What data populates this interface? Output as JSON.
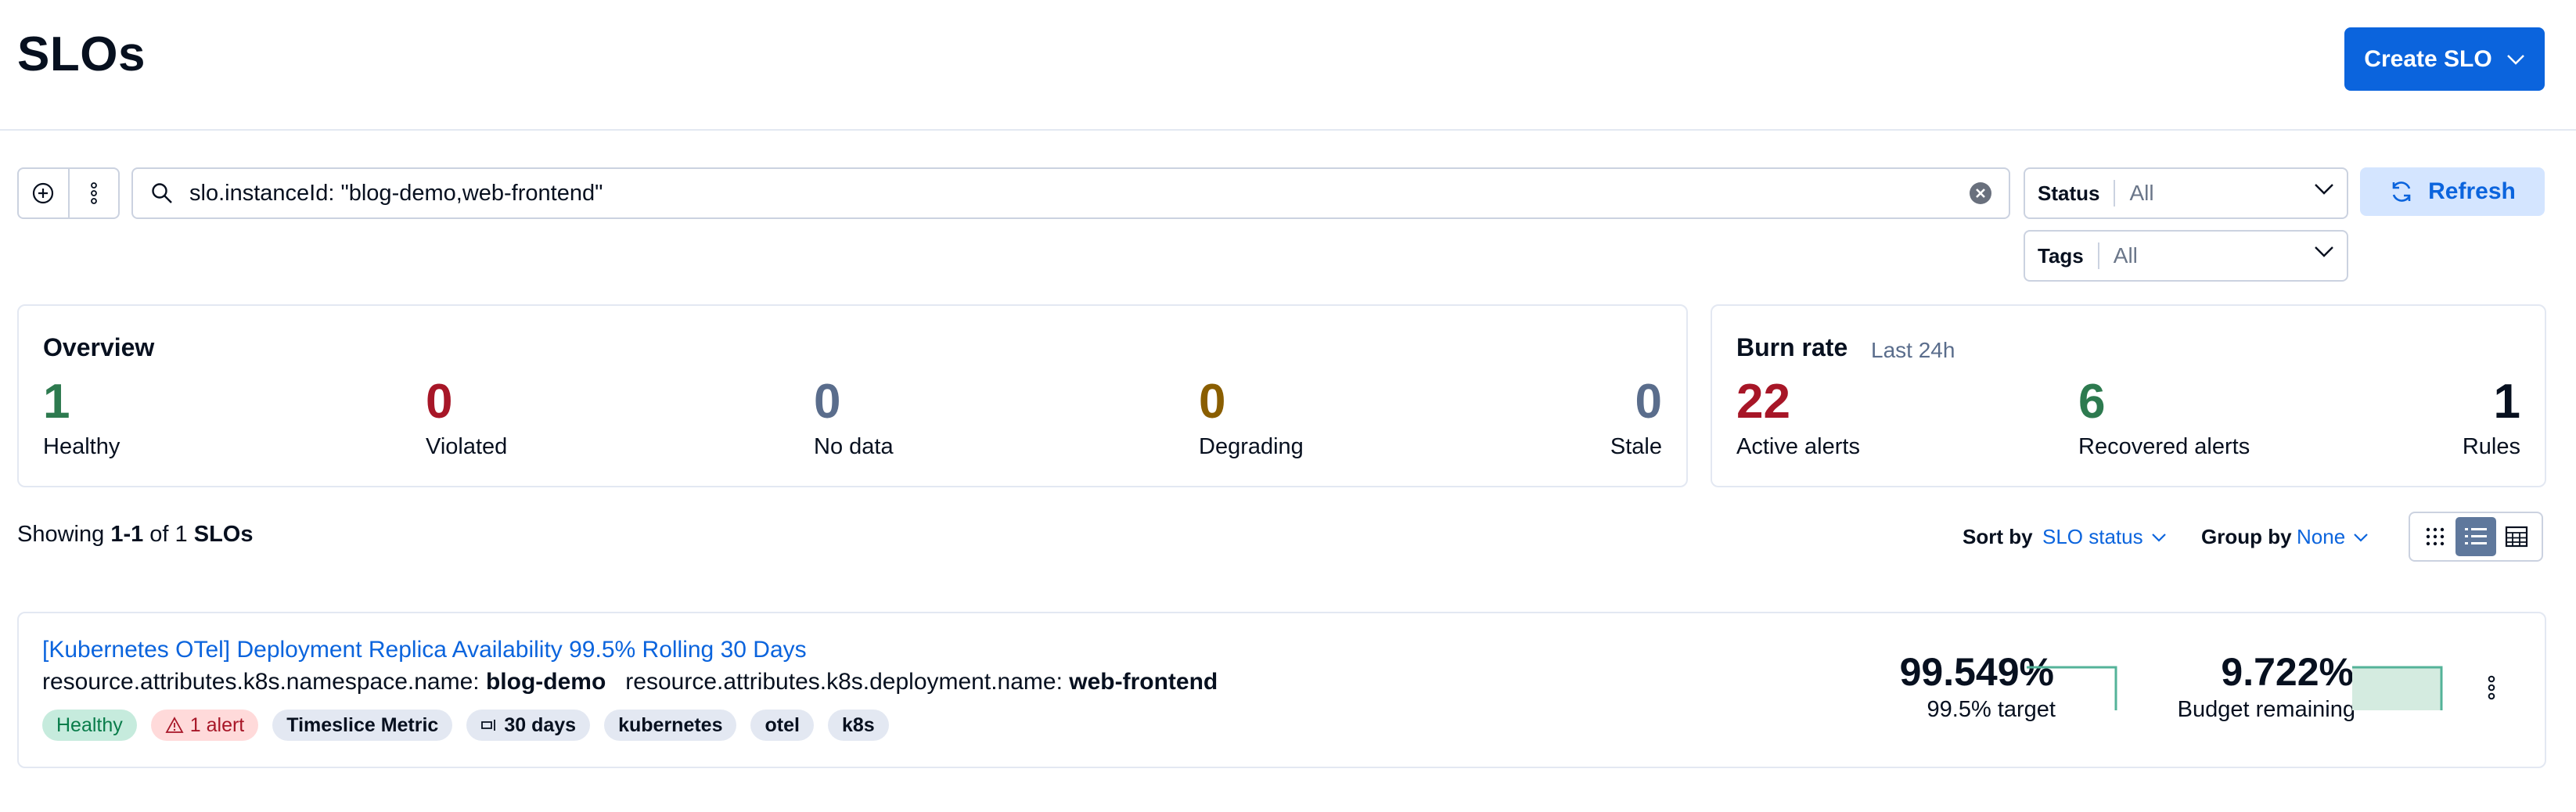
{
  "header": {
    "title": "SLOs",
    "create_label": "Create SLO"
  },
  "search": {
    "value": "slo.instanceId: \"blog-demo,web-frontend\""
  },
  "filters": {
    "status": {
      "label": "Status",
      "value": "All"
    },
    "tags": {
      "label": "Tags",
      "value": "All"
    },
    "refresh_label": "Refresh"
  },
  "overview": {
    "title": "Overview",
    "stats": [
      {
        "value": "1",
        "label": "Healthy",
        "color": "#2d7a4f"
      },
      {
        "value": "0",
        "label": "Violated",
        "color": "#a71627"
      },
      {
        "value": "0",
        "label": "No data",
        "color": "#5a6d8c"
      },
      {
        "value": "0",
        "label": "Degrading",
        "color": "#8a5e00"
      },
      {
        "value": "0",
        "label": "Stale",
        "color": "#5a6d8c"
      }
    ]
  },
  "burn_rate": {
    "title": "Burn rate",
    "subtitle": "Last 24h",
    "stats": [
      {
        "value": "22",
        "label": "Active alerts",
        "color": "#a71627"
      },
      {
        "value": "6",
        "label": "Recovered alerts",
        "color": "#2d7a4f"
      },
      {
        "value": "1",
        "label": "Rules",
        "color": "#07101f"
      }
    ]
  },
  "results": {
    "showing_prefix": "Showing",
    "range": "1-1",
    "of": "of",
    "total": "1",
    "unit": "SLOs"
  },
  "sort": {
    "sort_label": "Sort by",
    "sort_value": "SLO status",
    "group_label": "Group by",
    "group_value": "None"
  },
  "view_modes": [
    "grid-view-icon",
    "list-view-icon",
    "table-view-icon"
  ],
  "slo": {
    "name": "[Kubernetes OTel] Deployment Replica Availability 99.5% Rolling 30 Days",
    "instance": [
      {
        "key": "resource.attributes.k8s.namespace.name:",
        "value": "blog-demo"
      },
      {
        "key": "resource.attributes.k8s.deployment.name:",
        "value": "web-frontend"
      }
    ],
    "badges": {
      "status": "Healthy",
      "alerts": "1 alert",
      "indicator": "Timeslice Metric",
      "window": "30 days",
      "tags": [
        "kubernetes",
        "otel",
        "k8s"
      ]
    },
    "sli": {
      "value": "99.549%",
      "label": "99.5% target"
    },
    "budget": {
      "value": "9.722%",
      "label": "Budget remaining"
    }
  },
  "colors": {
    "accent": "#0b64dd",
    "healthy": "#2d7a4f",
    "violated": "#a71627",
    "degrading": "#8a5e00",
    "sparkline": "#54b399"
  }
}
